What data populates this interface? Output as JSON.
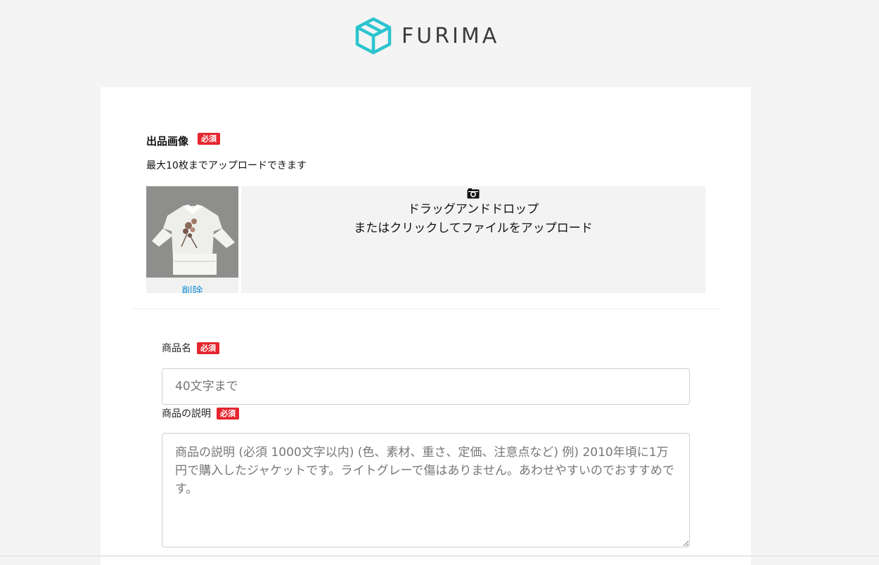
{
  "header": {
    "logo_text": "FURIMA",
    "brand_color": "#2bc4cf"
  },
  "image_section": {
    "title": "出品画像",
    "required_badge": "必須",
    "note": "最大10枚までアップロードできます",
    "thumbnail": {
      "delete_label": "削除"
    },
    "dropzone": {
      "icon": "camera-icon",
      "line1": "ドラッグアンドドロップ",
      "line2": "またはクリックしてファイルをアップロード"
    }
  },
  "product_name": {
    "label": "商品名",
    "required_badge": "必須",
    "placeholder": "40文字まで",
    "value": ""
  },
  "product_description": {
    "label": "商品の説明",
    "required_badge": "必須",
    "placeholder": "商品の説明 (必須 1000文字以内) (色、素材、重さ、定価、注意点など) 例) 2010年頃に1万円で購入したジャケットです。ライトグレーで傷はありません。あわせやすいのでおすすめです。",
    "value": ""
  },
  "colors": {
    "required_badge_bg": "#e5262f",
    "link": "#1a8fd6",
    "page_bg": "#f4f4f4"
  }
}
